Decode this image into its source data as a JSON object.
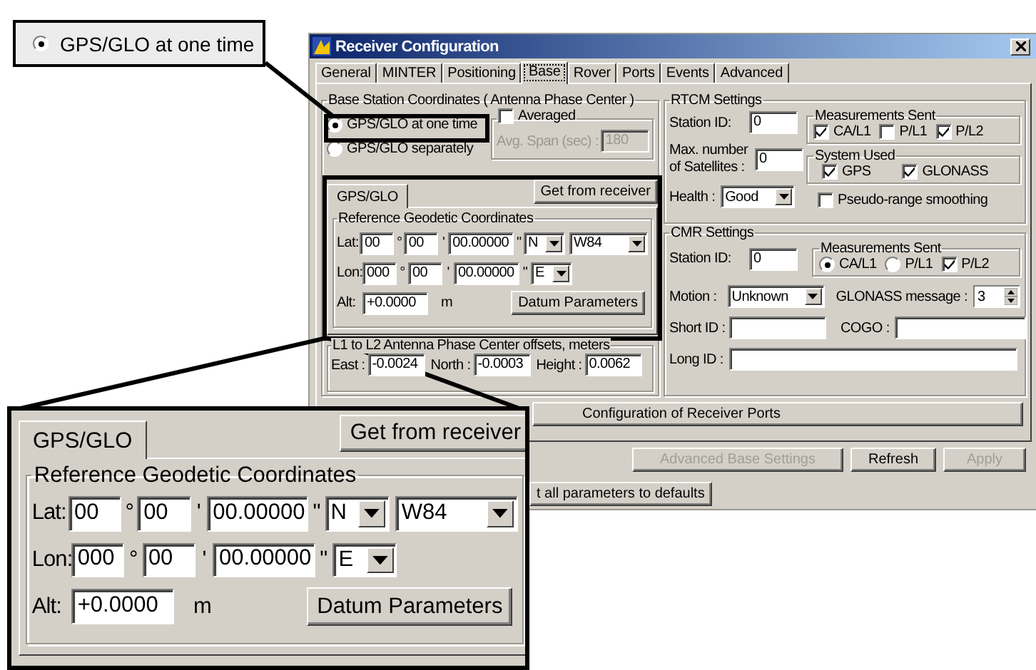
{
  "callout_top": {
    "label": "GPS/GLO at one time",
    "selected": true
  },
  "window": {
    "title": "Receiver Configuration"
  },
  "tabs": [
    {
      "label": "General",
      "selected": false
    },
    {
      "label": "MINTER",
      "selected": false
    },
    {
      "label": "Positioning",
      "selected": false
    },
    {
      "label": "Base",
      "selected": true
    },
    {
      "label": "Rover",
      "selected": false
    },
    {
      "label": "Ports",
      "selected": false
    },
    {
      "label": "Events",
      "selected": false
    },
    {
      "label": "Advanced",
      "selected": false
    }
  ],
  "base_station": {
    "legend": "Base Station Coordinates ( Antenna Phase Center )",
    "modes": [
      {
        "label": "GPS/GLO at one time",
        "selected": true
      },
      {
        "label": "GPS/GLO separately",
        "selected": false
      }
    ],
    "averaged": {
      "label": "Averaged",
      "checked": false
    },
    "avg_span": {
      "label": "Avg. Span (sec) :",
      "value": "180",
      "disabled": true
    }
  },
  "coord_panel": {
    "tab": "GPS/GLO",
    "get_button": "Get from receiver",
    "legend": "Reference Geodetic Coordinates",
    "lat": {
      "label": "Lat:",
      "deg": "00",
      "deg_mark": "°",
      "min": "00",
      "min_mark": "'",
      "sec": "00.00000",
      "sec_mark": "\"",
      "hemisphere": "N",
      "datum": "W84"
    },
    "lon": {
      "label": "Lon:",
      "deg": "000",
      "deg_mark": "°",
      "min": "00",
      "min_mark": "'",
      "sec": "00.00000",
      "sec_mark": "\"",
      "hemisphere": "E"
    },
    "alt": {
      "label": "Alt:",
      "value": "+0.0000",
      "unit": "m"
    },
    "datum_button": "Datum Parameters"
  },
  "offsets": {
    "legend": "L1 to L2 Antenna Phase Center offsets, meters",
    "fields": [
      {
        "label": "East :",
        "value": "-0.0024"
      },
      {
        "label": "North :",
        "value": "-0.0003"
      },
      {
        "label": "Height :",
        "value": "0.0062"
      }
    ]
  },
  "rtcm": {
    "legend": "RTCM Settings",
    "station_id": {
      "label": "Station ID:",
      "value": "0"
    },
    "max_sats": {
      "label": "Max. number of Satellites :",
      "value": "0"
    },
    "health": {
      "label": "Health :",
      "value": "Good"
    },
    "measurements": {
      "legend": "Measurements Sent",
      "items": [
        {
          "label": "CA/L1",
          "checked": true
        },
        {
          "label": "P/L1",
          "checked": false
        },
        {
          "label": "P/L2",
          "checked": true
        }
      ]
    },
    "system": {
      "legend": "System Used",
      "items": [
        {
          "label": "GPS",
          "checked": true
        },
        {
          "label": "GLONASS",
          "checked": true
        }
      ]
    },
    "smoothing": {
      "label": "Pseudo-range smoothing",
      "checked": false
    }
  },
  "cmr": {
    "legend": "CMR Settings",
    "station_id": {
      "label": "Station ID:",
      "value": "0"
    },
    "measurements": {
      "legend": "Measurements Sent",
      "items": [
        {
          "kind": "radio",
          "label": "CA/L1",
          "selected": true
        },
        {
          "kind": "radio",
          "label": "P/L1",
          "selected": false
        },
        {
          "kind": "checkbox",
          "label": "P/L2",
          "checked": true
        }
      ]
    },
    "motion": {
      "label": "Motion :",
      "value": "Unknown"
    },
    "glonass_message": {
      "label": "GLONASS message :",
      "value": "3"
    },
    "short_id": {
      "label": "Short ID :"
    },
    "cogo": {
      "label": "COGO :"
    },
    "long_id": {
      "label": "Long ID :"
    }
  },
  "ports_button": "Configuration of Receiver Ports",
  "actions": [
    {
      "label": "Advanced Base Settings",
      "disabled": true
    },
    {
      "label": "Refresh",
      "disabled": false
    },
    {
      "label": "Apply",
      "disabled": true
    }
  ],
  "reset_button": "t all parameters to defaults",
  "callout_panel": {
    "tab": "GPS/GLO",
    "get_button": "Get from receiver",
    "legend": "Reference Geodetic Coordinates",
    "lat": {
      "label": "Lat:",
      "deg": "00",
      "deg_mark": "°",
      "min": "00",
      "min_mark": "'",
      "sec": "00.00000",
      "sec_mark": "\"",
      "hemisphere": "N",
      "datum": "W84"
    },
    "lon": {
      "label": "Lon:",
      "deg": "000",
      "deg_mark": "°",
      "min": "00",
      "min_mark": "'",
      "sec": "00.00000",
      "sec_mark": "\"",
      "hemisphere": "E"
    },
    "alt": {
      "label": "Alt:",
      "value": "+0.0000",
      "unit": "m"
    },
    "datum_button": "Datum Parameters"
  }
}
